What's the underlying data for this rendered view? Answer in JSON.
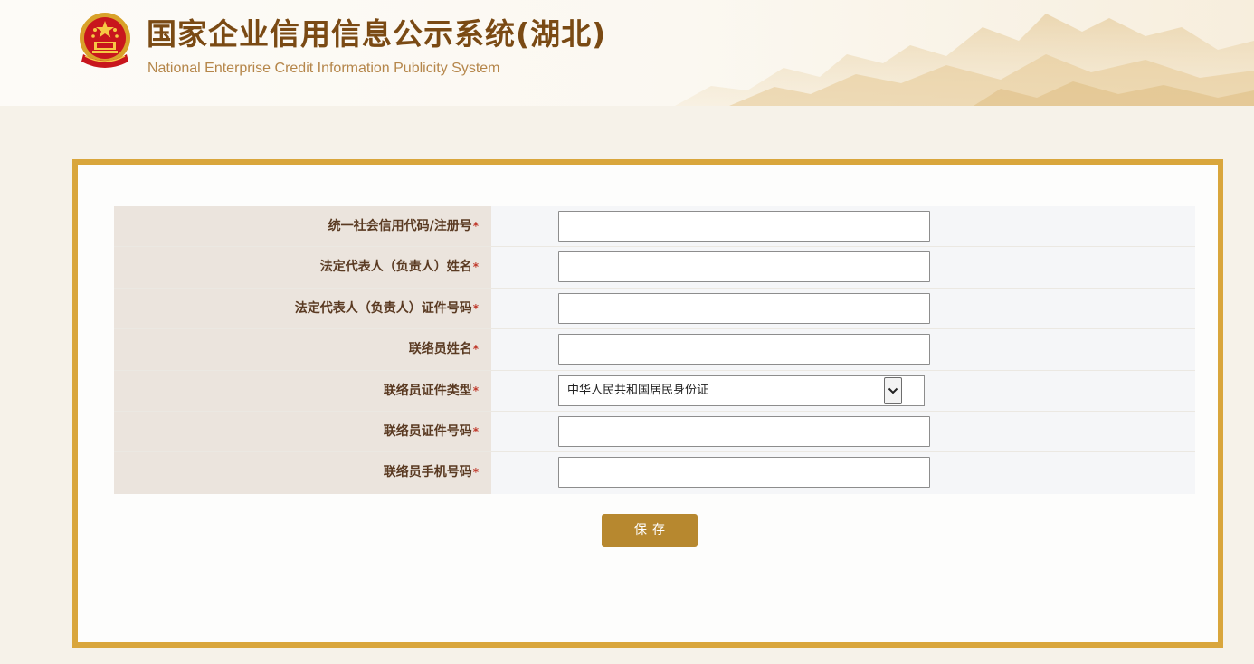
{
  "header": {
    "title": "国家企业信用信息公示系统(湖北)",
    "subtitle": "National Enterprise Credit Information Publicity System",
    "emblem_icon": "national-emblem-icon",
    "title_color": "#7a4a14",
    "subtitle_color": "#b5864a"
  },
  "form": {
    "required_mark": "*",
    "rows": [
      {
        "label": "统一社会信用代码/注册号",
        "type": "text",
        "value": ""
      },
      {
        "label": "法定代表人（负责人）姓名",
        "type": "text",
        "value": ""
      },
      {
        "label": "法定代表人（负责人）证件号码",
        "type": "text",
        "value": ""
      },
      {
        "label": "联络员姓名",
        "type": "text",
        "value": ""
      },
      {
        "label": "联络员证件类型",
        "type": "select",
        "value": "中华人民共和国居民身份证",
        "icon": "chevron-down-icon"
      },
      {
        "label": "联络员证件号码",
        "type": "text",
        "value": ""
      },
      {
        "label": "联络员手机号码",
        "type": "text",
        "value": ""
      }
    ]
  },
  "actions": {
    "save_label": "保存"
  },
  "colors": {
    "card_border": "#d9a63c",
    "label_bg": "#ebe4dd",
    "button_bg": "#b7882f",
    "page_bg": "#f6f2e9"
  }
}
